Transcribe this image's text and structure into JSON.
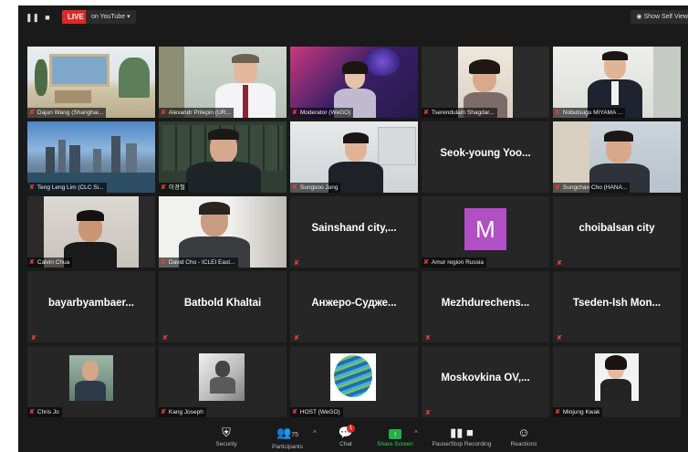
{
  "topbar": {
    "live": "LIVE",
    "youtube": "on YouTube",
    "show_self": "Show Self View"
  },
  "tiles": [
    {
      "name": "Dajun Wang (Shanghai..."
    },
    {
      "name": "Alexandr Prilepin (UR..."
    },
    {
      "name": "Moderator (WeGO)"
    },
    {
      "name": "Tserendulam Shagdar..."
    },
    {
      "name": "Nobutsugu MIYAMA ..."
    },
    {
      "name": "Teng Leng Lim (CLC Si..."
    },
    {
      "name": "이경철"
    },
    {
      "name": "Sungsoo Jung"
    },
    {
      "display": "Seok-young Yoo..."
    },
    {
      "name": "Sungchan Cho (HANA..."
    },
    {
      "name": "Calvin Chua"
    },
    {
      "name": "David Cho - ICLEI East..."
    },
    {
      "display": "Sainshand  city,..."
    },
    {
      "name": "Amur region Russia",
      "initial": "M"
    },
    {
      "display": "choibalsan city"
    },
    {
      "display": "bayarbyambaer..."
    },
    {
      "display": "Batbold Khaltai"
    },
    {
      "display": "Анжеро-Судже..."
    },
    {
      "display": "Mezhdurechens..."
    },
    {
      "display": "Tseden-Ish  Mon..."
    },
    {
      "name": "Chris Jo"
    },
    {
      "name": "Kang Joseph"
    },
    {
      "name": "HOST (WeGO)"
    },
    {
      "display": "Moskovkina OV,..."
    },
    {
      "name": "Minjung Kwak"
    }
  ],
  "toolbar": {
    "security": "Security",
    "participants": "Participants",
    "participants_count": "75",
    "chat": "Chat",
    "chat_badge": "1",
    "share": "Share Screen",
    "recording": "Pause/Stop Recording",
    "reactions": "Reactions"
  },
  "colors": {
    "live": "#e02828",
    "active_speaker": "#d8d84a",
    "avatar_m": "#b14fc4",
    "share": "#23b04a"
  }
}
